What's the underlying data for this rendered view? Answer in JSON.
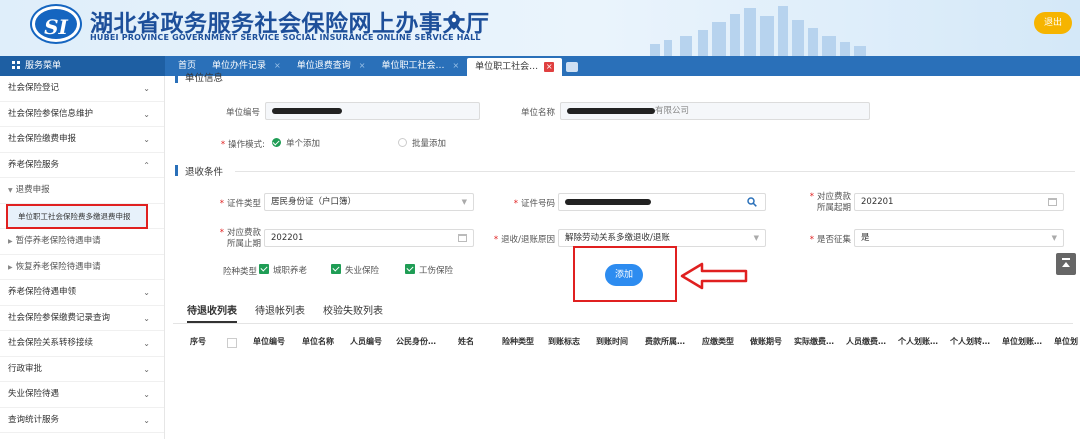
{
  "header": {
    "logo_text": "SI",
    "title_cn": "湖北省政务服务社会保险网上办事大厅",
    "title_en": "HUBEI PROVINCE GOVERNMENT SERVICE SOCIAL INSURANCE ONLINE SERVICE HALL",
    "logout_label": "退出",
    "accent": "#1d4f9a",
    "logout_color": "#f6b400"
  },
  "nav": {
    "menu_title": "服务菜单",
    "tabs": [
      {
        "label": "首页"
      },
      {
        "label": "单位办件记录",
        "close": "×"
      },
      {
        "label": "单位退费查询",
        "close": "×"
      },
      {
        "label": "单位职工社会…",
        "close": "×"
      },
      {
        "label": "单位职工社会…",
        "close": "×",
        "active": true
      }
    ],
    "bar_color": "#2a70b9"
  },
  "sidebar": {
    "items": [
      {
        "label": "社会保险登记",
        "chevron": "⌄"
      },
      {
        "label": "社会保险参保信息维护",
        "chevron": "⌄"
      },
      {
        "label": "社会保险缴费申报",
        "chevron": "⌄"
      },
      {
        "label": "养老保险服务",
        "chevron": "⌃"
      },
      {
        "label": "退费申报",
        "tri": "▼"
      },
      {
        "label": ""
      },
      {
        "label": "暂停养老保险待遇申请",
        "tri": "▶"
      },
      {
        "label": "恢复养老保险待遇申请",
        "tri": "▶"
      },
      {
        "label": "养老保险待遇申领",
        "chevron": "⌄"
      },
      {
        "label": "社会保险参保缴费记录查询",
        "chevron": "⌄"
      },
      {
        "label": "社会保险关系转移接续",
        "chevron": "⌄"
      },
      {
        "label": "行政审批",
        "chevron": "⌄"
      },
      {
        "label": "失业保险待遇",
        "chevron": "⌄"
      },
      {
        "label": "查询统计服务",
        "chevron": "⌄"
      }
    ],
    "selected_leaf": "单位职工社会保险费多缴退费申报"
  },
  "unit_info": {
    "section_title": "单位信息",
    "unit_no_label": "单位编号",
    "unit_name_label": "单位名称",
    "unit_name_suffix": "有限公司",
    "op_mode_label": "操作模式:",
    "op_single": "单个添加",
    "op_batch": "批量添加"
  },
  "refund": {
    "section_title": "退收条件",
    "id_type_label": "证件类型",
    "id_type_value": "居民身份证（户口簿）",
    "id_no_label": "证件号码",
    "period_start_label_1": "对应费款",
    "period_start_label_2": "所属起期",
    "period_start_value": "202201",
    "period_end_label_1": "对应费款",
    "period_end_label_2": "所属止期",
    "period_end_value": "202201",
    "reason_label": "退收/退账原因",
    "reason_value": "解除劳动关系多缴退收/退账",
    "levy_label": "是否征集",
    "levy_value": "是",
    "insurance_label": "险种类型",
    "insurances": [
      "城职养老",
      "失业保险",
      "工伤保险"
    ],
    "add_label": "添加"
  },
  "list": {
    "tabs": [
      "待退收列表",
      "待退帐列表",
      "校验失败列表"
    ],
    "columns": [
      "序号",
      "单位编号",
      "单位名称",
      "人员编号",
      "公民身份…",
      "姓名",
      "险种类型",
      "到账标志",
      "到账时间",
      "费款所属…",
      "应缴类型",
      "做账期号",
      "实际缴费…",
      "人员缴费…",
      "个人划账…",
      "个人划转…",
      "单位划账…",
      "单位划"
    ]
  }
}
